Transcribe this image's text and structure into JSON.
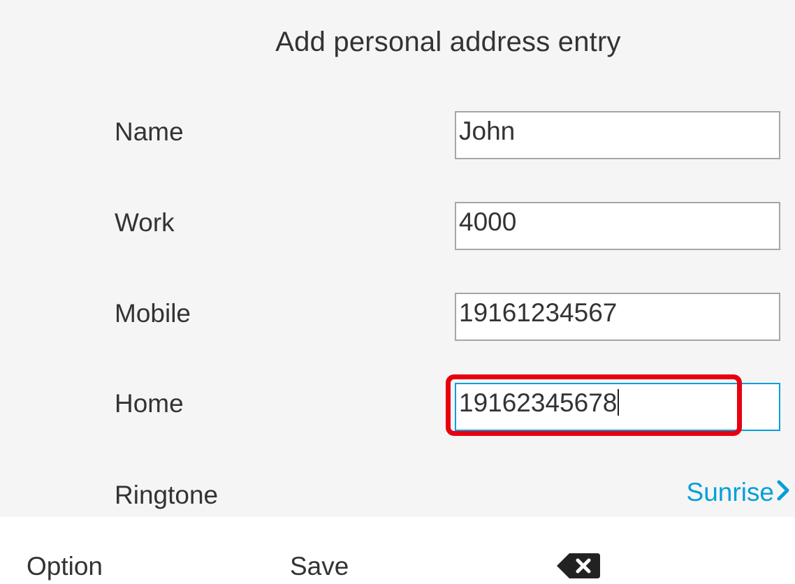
{
  "title": "Add personal address entry",
  "fields": [
    {
      "label": "Name",
      "value": "John"
    },
    {
      "label": "Work",
      "value": "4000"
    },
    {
      "label": "Mobile",
      "value": "19161234567"
    },
    {
      "label": "Home",
      "value": "19162345678"
    }
  ],
  "ringtone": {
    "label": "Ringtone",
    "value": "Sunrise",
    "icon": "chevron-right-icon"
  },
  "softkeys": {
    "option": "Option",
    "save": "Save",
    "backspace_icon": "backspace-icon"
  },
  "colors": {
    "accent": "#049fd9",
    "highlight": "#e8000e"
  }
}
